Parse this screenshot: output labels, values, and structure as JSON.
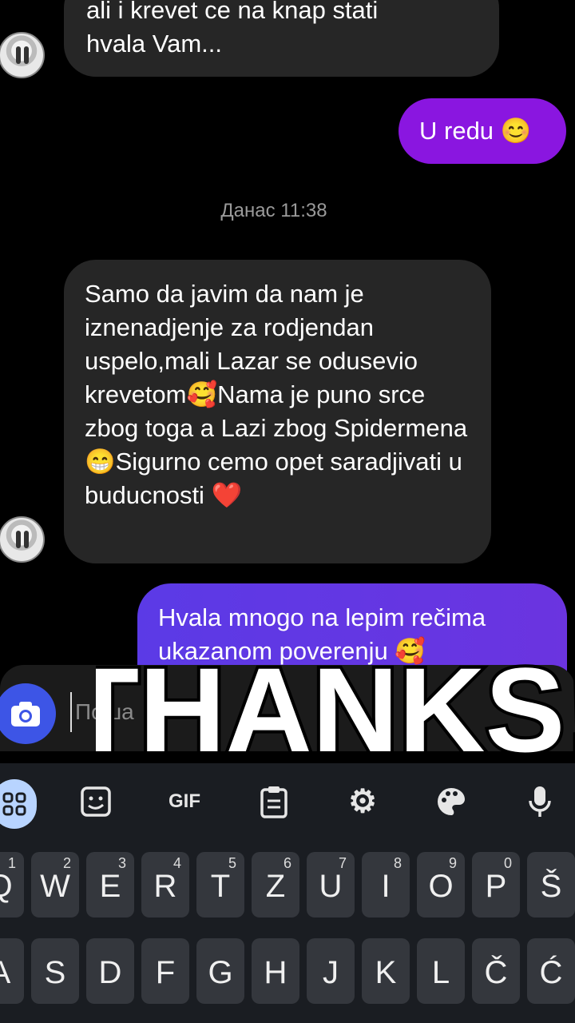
{
  "messages": {
    "incoming_top": "ali i krevet ce na knap stati\nhvala Vam...",
    "outgoing_1": "U redu 😊",
    "timestamp": "Данас 11:38",
    "incoming_main": "Samo da javim da nam je iznenadjenje za rodjendan uspelo,mali Lazar se odusevio krevetom🥰Nama je puno srce zbog toga a Lazi zbog Spidermena😁Sigurno cemo opet saradjivati u buducnosti ❤️",
    "outgoing_2": "Hvala mnogo na lepim rečima\nukazanom poverenju 🥰"
  },
  "composer": {
    "placeholder": "Поша"
  },
  "overlay": {
    "sticker_text": "THANKS!"
  },
  "keyboard": {
    "toolbar": [
      "apps-icon",
      "sticker-icon",
      "GIF",
      "clipboard-icon",
      "gear-icon",
      "palette-icon",
      "mic-icon"
    ],
    "row1": [
      {
        "k": "Q",
        "n": ""
      },
      {
        "k": "W",
        "n": "2"
      },
      {
        "k": "E",
        "n": "3"
      },
      {
        "k": "R",
        "n": "4"
      },
      {
        "k": "T",
        "n": "5"
      },
      {
        "k": "Z",
        "n": "6"
      },
      {
        "k": "U",
        "n": "7"
      },
      {
        "k": "I",
        "n": "8"
      },
      {
        "k": "O",
        "n": "9"
      },
      {
        "k": "P",
        "n": "0"
      },
      {
        "k": "Š",
        "n": ""
      }
    ],
    "row1_first_num": "1",
    "row2": [
      "A",
      "S",
      "D",
      "F",
      "G",
      "H",
      "J",
      "K",
      "L",
      "Č",
      "Ć"
    ]
  },
  "colors": {
    "outgoing_1": "#8a16e0",
    "outgoing_2_from": "#5b3ae6",
    "outgoing_2_to": "#6b34e0",
    "camera": "#3d55e6"
  }
}
